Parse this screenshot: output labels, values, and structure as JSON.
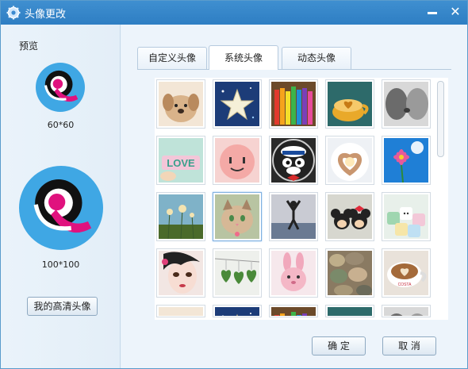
{
  "window": {
    "title": "头像更改",
    "minimize_label": "",
    "close_label": "✕"
  },
  "preview": {
    "label": "预览",
    "small_size": "60*60",
    "large_size": "100*100",
    "hd_button": "我的高清头像"
  },
  "tabs": [
    {
      "label": "自定义头像",
      "active": false
    },
    {
      "label": "系统头像",
      "active": true
    },
    {
      "label": "动态头像",
      "active": false
    }
  ],
  "avatars": [
    {
      "icon": "puppy-plush-icon",
      "selected": false
    },
    {
      "icon": "star-icon",
      "selected": false
    },
    {
      "icon": "colored-pencils-icon",
      "selected": false
    },
    {
      "icon": "heart-coffee-cup-icon",
      "selected": false
    },
    {
      "icon": "kiss-couple-icon",
      "selected": false
    },
    {
      "icon": "love-letters-icon",
      "selected": false
    },
    {
      "icon": "smiley-face-icon",
      "selected": false
    },
    {
      "icon": "sailor-cat-icon",
      "selected": false
    },
    {
      "icon": "heart-hands-icon",
      "selected": false
    },
    {
      "icon": "flower-sky-icon",
      "selected": false
    },
    {
      "icon": "dandelion-field-icon",
      "selected": false
    },
    {
      "icon": "kitten-icon",
      "selected": true
    },
    {
      "icon": "jumping-silhouette-icon",
      "selected": false
    },
    {
      "icon": "mickey-minnie-icon",
      "selected": false
    },
    {
      "icon": "marshmallows-icon",
      "selected": false
    },
    {
      "icon": "doll-face-icon",
      "selected": false
    },
    {
      "icon": "hanging-hearts-icon",
      "selected": false
    },
    {
      "icon": "pink-bunny-icon",
      "selected": false
    },
    {
      "icon": "pebbles-icon",
      "selected": false
    },
    {
      "icon": "latte-cup-icon",
      "selected": false
    }
  ],
  "actions": {
    "ok": "确 定",
    "cancel": "取 消"
  },
  "colors": {
    "titlebar": "#3580c8",
    "logo_blue": "#42a9e6",
    "logo_magenta": "#e0127e"
  }
}
